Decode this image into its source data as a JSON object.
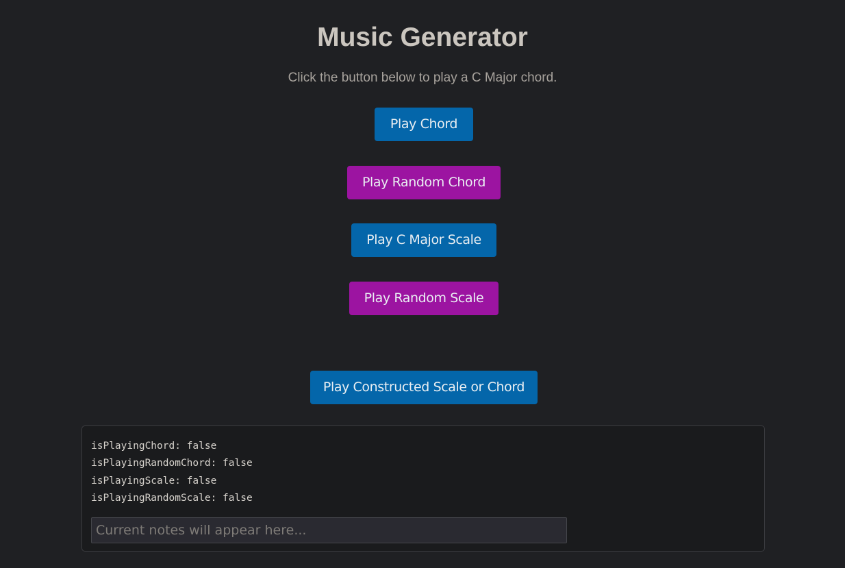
{
  "page": {
    "title": "Music Generator",
    "subtitle": "Click the button below to play a C Major chord."
  },
  "buttons": {
    "play_chord": "Play Chord",
    "play_random_chord": "Play Random Chord",
    "play_c_major_scale": "Play C Major Scale",
    "play_random_scale": "Play Random Scale",
    "play_constructed": "Play Constructed Scale or Chord"
  },
  "status": {
    "lines": [
      "isPlayingChord: false",
      "isPlayingRandomChord: false",
      "isPlayingScale: false",
      "isPlayingRandomScale: false"
    ]
  },
  "notes": {
    "value": "",
    "placeholder": "Current notes will appear here..."
  },
  "colors": {
    "background": "#1f2023",
    "primary_button": "#0466aa",
    "accent_button": "#9c14a1",
    "panel": "#1a1b1d"
  }
}
